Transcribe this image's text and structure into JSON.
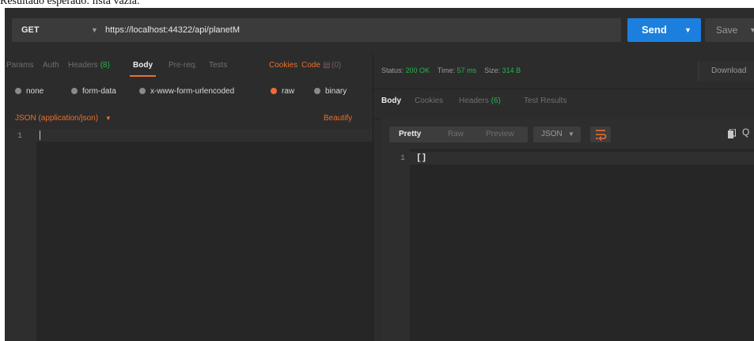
{
  "caption": "Resultado esperado: lista vazia.",
  "request": {
    "method": "GET",
    "url": "https://localhost:44322/api/planetM",
    "send_label": "Send",
    "save_label": "Save"
  },
  "request_tabs": [
    {
      "label": "Params"
    },
    {
      "label": "Auth"
    },
    {
      "label": "Headers",
      "count": "(8)"
    },
    {
      "label": "Body"
    },
    {
      "label": "Pre-req."
    },
    {
      "label": "Tests"
    }
  ],
  "cookies_label": "Cookies",
  "code_label": "Code",
  "comments_count": "(0)",
  "body_types": [
    "none",
    "form-data",
    "x-www-form-urlencoded",
    "raw",
    "binary"
  ],
  "content_type": "JSON (application/json)",
  "beautify_label": "Beautify",
  "request_editor": {
    "line_number": "1"
  },
  "response": {
    "status_label": "Status:",
    "status": "200 OK",
    "time_label": "Time:",
    "time": "57 ms",
    "size_label": "Size:",
    "size": "314 B",
    "download_label": "Download",
    "tabs": [
      {
        "label": "Body"
      },
      {
        "label": "Cookies"
      },
      {
        "label": "Headers",
        "count": "(6)"
      },
      {
        "label": "Test Results"
      }
    ],
    "view_modes": [
      "Pretty",
      "Raw",
      "Preview"
    ],
    "format": "JSON",
    "line_number": "1",
    "body": "[]"
  },
  "colors": {
    "accent": "#f06d2f",
    "send": "#1c7fde",
    "success": "#28b44d",
    "background": "#2c2c2c"
  }
}
